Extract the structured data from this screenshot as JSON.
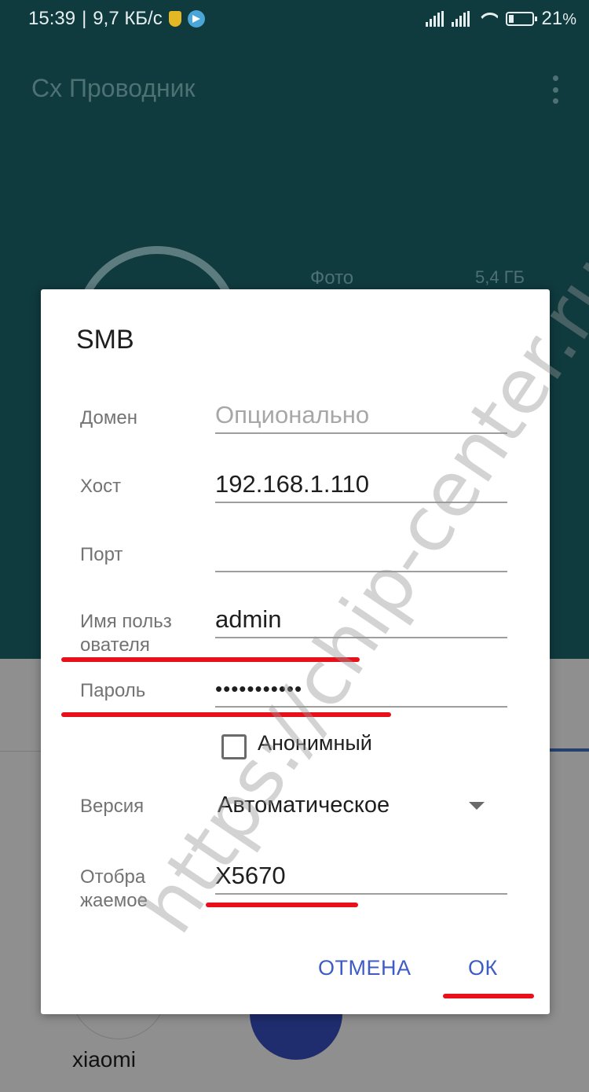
{
  "status_bar": {
    "time": "15:39",
    "separator": "|",
    "network_speed": "9,7 КБ/с",
    "battery_percent": "21",
    "battery_unit": "%",
    "icons": [
      "shield-icon",
      "telegram-icon",
      "signal-icon",
      "signal-icon",
      "wifi-icon",
      "battery-icon"
    ]
  },
  "app": {
    "title": "Cx Проводник",
    "storage_stat": {
      "label": "Фото",
      "value": "5,4 ГБ"
    },
    "device_label": "xiaomi"
  },
  "dialog": {
    "title": "SMB",
    "fields": {
      "domain": {
        "label": "Домен",
        "value": "",
        "placeholder": "Опционально"
      },
      "host": {
        "label": "Хост",
        "value": "192.168.1.110"
      },
      "port": {
        "label": "Порт",
        "value": ""
      },
      "username": {
        "label_line1": "Имя польз",
        "label_line2": "ователя",
        "value": "admin"
      },
      "password": {
        "label": "Пароль",
        "value": "•••••••••••"
      },
      "version": {
        "label": "Версия",
        "value": "Автоматическое"
      },
      "display": {
        "label_line1": "Отобра",
        "label_line2": "жаемое",
        "value": "X5670"
      }
    },
    "anonymous_checkbox": {
      "label": "Анонимный",
      "checked": false
    },
    "buttons": {
      "cancel": "ОТМЕНА",
      "ok": "ОК"
    },
    "accent_color": "#3f5bc4"
  },
  "watermark": "https://chip-center.ru"
}
